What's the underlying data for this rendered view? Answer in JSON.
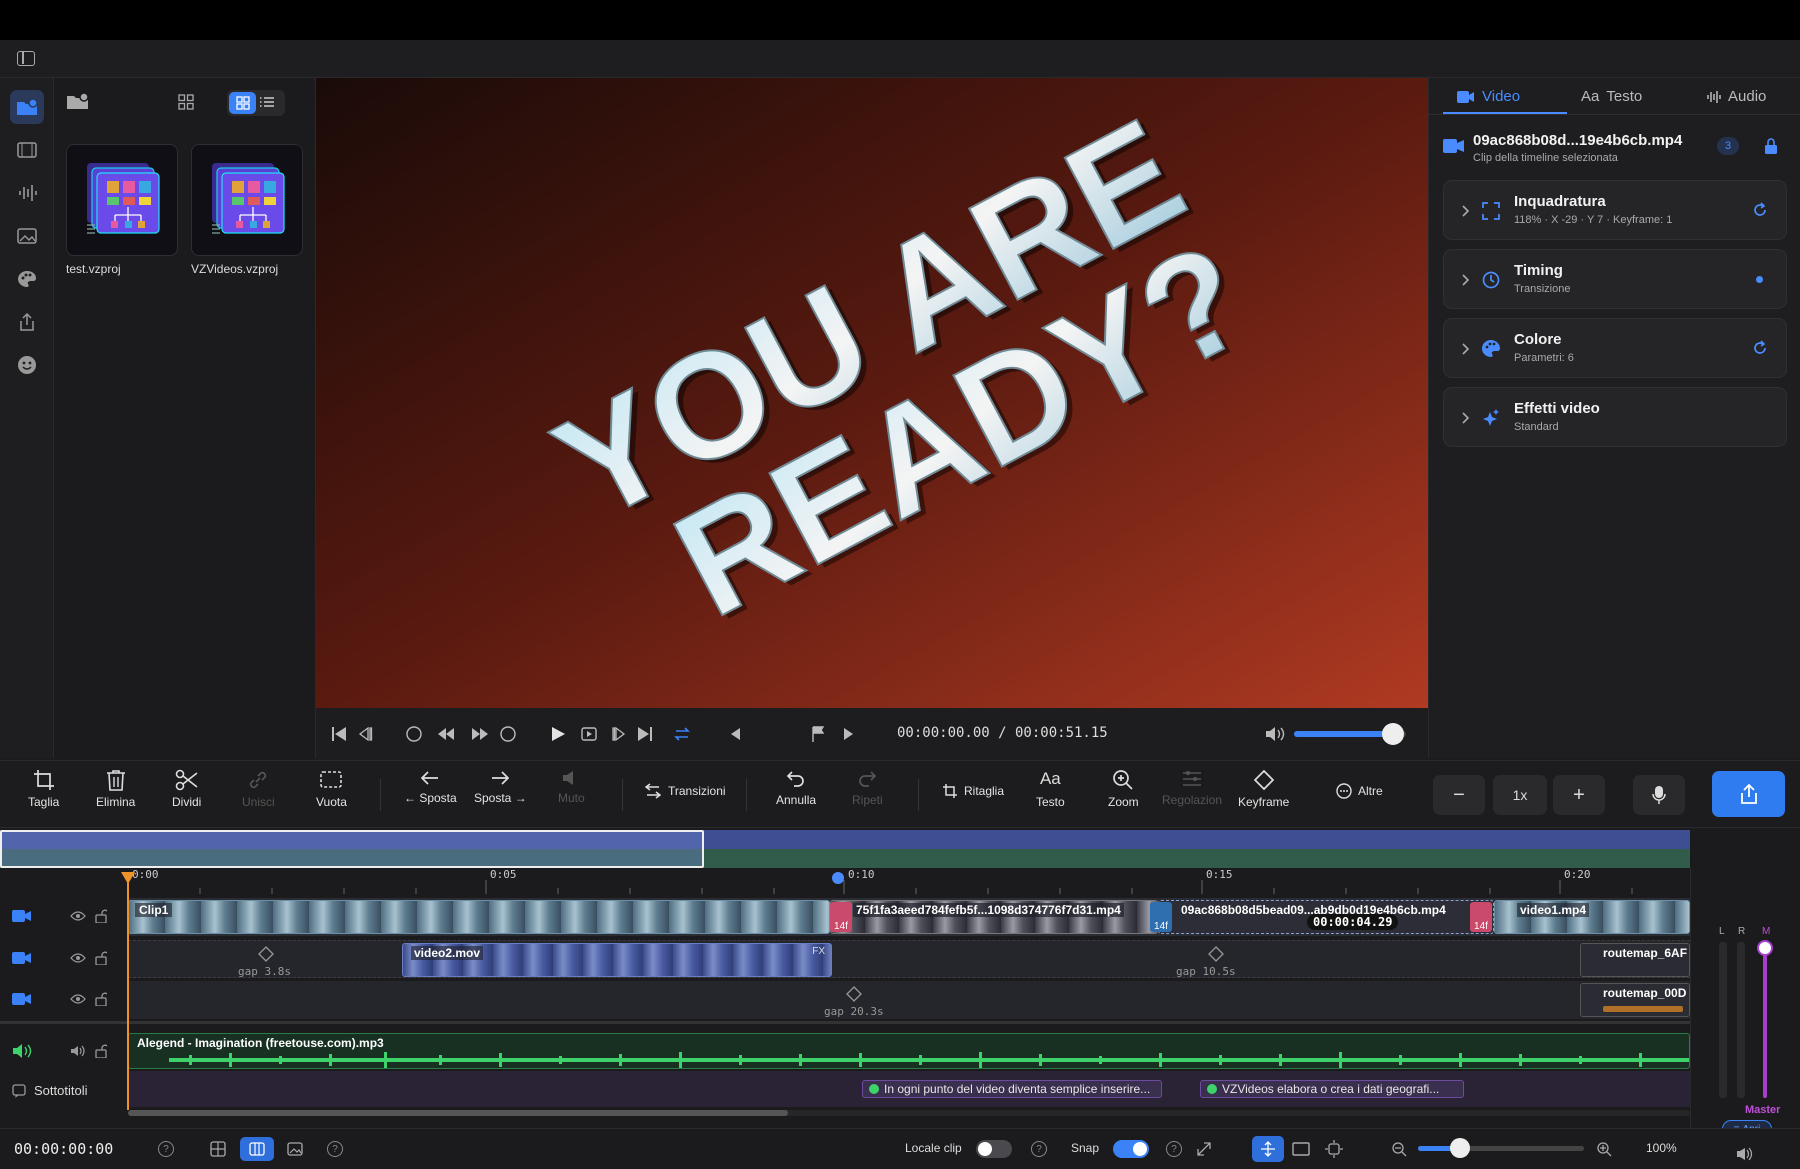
{
  "media": {
    "items": [
      {
        "name": "test.vzproj"
      },
      {
        "name": "VZVideos.vzproj"
      }
    ]
  },
  "preview": {
    "overlay_line1": "YOU ARE",
    "overlay_line2": "READY?"
  },
  "transport": {
    "timecode": "00:00:00.00 / 00:00:51.15",
    "volume": 0.88
  },
  "inspector": {
    "tabs": [
      {
        "label": "Video",
        "icon": "video-camera-icon",
        "active": true
      },
      {
        "label": "Testo",
        "prefix": "Aa",
        "active": false
      },
      {
        "label": "Audio",
        "icon": "waveform-icon",
        "active": false
      }
    ],
    "clip": {
      "name": "09ac868b08d...19e4b6cb.mp4",
      "subtitle": "Clip della timeline selezionata",
      "badge": "3"
    },
    "sections": [
      {
        "title": "Inquadratura",
        "sub": "118% · X -29 · Y 7 · Keyframe: 1",
        "icon": "crop-frame-icon",
        "action": "reset-icon"
      },
      {
        "title": "Timing",
        "sub": "Transizione",
        "icon": "clock-icon",
        "action": "dot-indicator"
      },
      {
        "title": "Colore",
        "sub": "Parametri: 6",
        "icon": "palette-icon",
        "action": "reset-icon"
      },
      {
        "title": "Effetti video",
        "sub": "Standard",
        "icon": "sparkle-icon",
        "action": ""
      }
    ]
  },
  "toolbar": {
    "tools": [
      {
        "label": "Taglia",
        "icon": "crop-icon",
        "enabled": true
      },
      {
        "label": "Elimina",
        "icon": "trash-icon",
        "enabled": true
      },
      {
        "label": "Dividi",
        "icon": "scissors-icon",
        "enabled": true
      },
      {
        "label": "Unisci",
        "icon": "link-icon",
        "enabled": false
      },
      {
        "label": "Vuota",
        "icon": "dashed-rect-icon",
        "enabled": true
      },
      {
        "label": "← Sposta",
        "icon": "arrow-left-icon",
        "enabled": true
      },
      {
        "label": "Sposta →",
        "icon": "arrow-right-icon",
        "enabled": true
      },
      {
        "label": "Muto",
        "icon": "mute-icon",
        "enabled": false
      },
      {
        "label": "Transizioni",
        "icon": "transition-icon",
        "enabled": true
      },
      {
        "label": "Annulla",
        "icon": "undo-icon",
        "enabled": true
      },
      {
        "label": "Ripeti",
        "icon": "redo-icon",
        "enabled": false
      },
      {
        "label": "Ritaglia",
        "icon": "crop-icon",
        "enabled": true
      },
      {
        "label": "Testo",
        "prefix": "Aa",
        "enabled": true
      },
      {
        "label": "Zoom",
        "icon": "zoom-icon",
        "enabled": true
      },
      {
        "label": "Regolazion",
        "icon": "sliders-icon",
        "enabled": false
      },
      {
        "label": "Keyframe",
        "icon": "diamond-icon",
        "enabled": true
      },
      {
        "label": "Altre",
        "icon": "more-icon",
        "enabled": true
      }
    ],
    "speed": "1x",
    "minus": "−",
    "plus": "+"
  },
  "timeline": {
    "ticks": [
      "0:00",
      "0:05",
      "0:10",
      "0:15",
      "0:20"
    ],
    "video_track1": {
      "clips": [
        {
          "title": "Clip1"
        },
        {
          "title": "75f1fa3aeed784fefb5f...1098d374776f7d31.mp4"
        },
        {
          "title": "09ac868b08d5bead09...ab9db0d19e4b6cb.mp4"
        },
        {
          "title": "video1.mp4"
        }
      ],
      "transition_badges": [
        "14f",
        "14f",
        "14f"
      ],
      "tooltip": "00:00:04.29"
    },
    "video_track2": {
      "clip": "video2.mov",
      "fx": "FX",
      "gaps": [
        "gap 3.8s",
        "gap 10.5s"
      ],
      "right_clip": "routemap_6AF"
    },
    "video_track3": {
      "gap": "gap 20.3s",
      "right_clip": "routemap_00D"
    },
    "audio_track": {
      "title": "Alegend - Imagination (freetouse.com).mp3"
    },
    "subtitles": {
      "label": "Sottotitoli",
      "chips": [
        "In ogni punto del video diventa semplice inserire...",
        "VZVideos elabora o crea i dati geografi..."
      ]
    },
    "meter": {
      "l": "L",
      "r": "R",
      "m": "M",
      "master": "Master",
      "open_label": "Apri"
    }
  },
  "status": {
    "timecode": "00:00:00:00",
    "locale_clip": "Locale clip",
    "locale_clip_on": false,
    "snap": "Snap",
    "snap_on": true,
    "zoom_pct": "100%",
    "zoom_level": 0.25
  },
  "colors": {
    "accent": "#3a82f6",
    "playhead": "#f0922a",
    "audio": "#3ed26a",
    "video_track": "#4f7ac7"
  }
}
